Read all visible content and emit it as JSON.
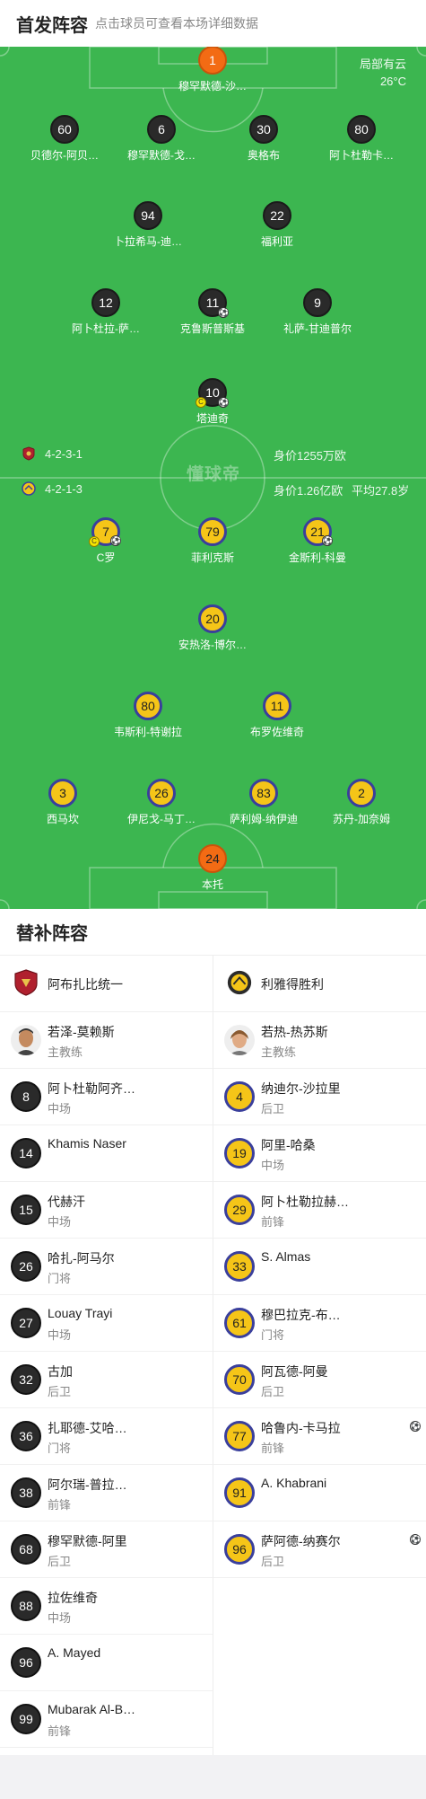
{
  "header": {
    "title": "首发阵容",
    "subtitle": "点击球员可查看本场详细数据"
  },
  "weather": {
    "condition": "局部有云",
    "temperature": "26°C"
  },
  "home_team": {
    "formation": "4-2-3-1",
    "value": "身价1255万欧",
    "colors": {
      "shirt": "#2a2a2a",
      "gk": "#f36b14",
      "logo": "#b0202e"
    },
    "players": [
      {
        "number": "1",
        "name": "穆罕默德-沙…",
        "gk": true
      },
      {
        "number": "60",
        "name": "贝德尔-阿贝…"
      },
      {
        "number": "6",
        "name": "穆罕默德-戈…"
      },
      {
        "number": "30",
        "name": "奥格布"
      },
      {
        "number": "80",
        "name": "阿卜杜勒卡…"
      },
      {
        "number": "94",
        "name": "卜拉希马-迪…"
      },
      {
        "number": "22",
        "name": "福利亚"
      },
      {
        "number": "12",
        "name": "阿卜杜拉-萨…"
      },
      {
        "number": "11",
        "name": "克鲁斯普斯基",
        "goal": true
      },
      {
        "number": "9",
        "name": "礼萨-甘迪普尔"
      },
      {
        "number": "10",
        "name": "塔迪奇",
        "captain": true,
        "goal": true
      }
    ]
  },
  "away_team": {
    "formation": "4-2-1-3",
    "value": "身价1.26亿欧",
    "avg_age": "平均27.8岁",
    "colors": {
      "shirt": "#f5c518",
      "trim": "#3a3f9c",
      "gk": "#f36b14"
    },
    "players": [
      {
        "number": "7",
        "name": "C罗",
        "captain": true,
        "goal": true
      },
      {
        "number": "79",
        "name": "菲利克斯"
      },
      {
        "number": "21",
        "name": "金斯利-科曼",
        "goal": true
      },
      {
        "number": "20",
        "name": "安热洛-博尔…"
      },
      {
        "number": "80",
        "name": "韦斯利-特谢拉"
      },
      {
        "number": "11",
        "name": "布罗佐维奇"
      },
      {
        "number": "3",
        "name": "西马坎"
      },
      {
        "number": "26",
        "name": "伊尼戈-马丁…"
      },
      {
        "number": "83",
        "name": "萨利姆-纳伊迪"
      },
      {
        "number": "2",
        "name": "苏丹-加奈姆"
      },
      {
        "number": "24",
        "name": "本托",
        "gk": true
      }
    ]
  },
  "watermark": "懂球帝",
  "subs": {
    "title": "替补阵容",
    "home": {
      "team_name": "阿布扎比统一",
      "coach": {
        "name": "若泽-莫赖斯",
        "role": "主教练"
      },
      "players": [
        {
          "number": "8",
          "name": "阿卜杜勒阿齐…",
          "pos": "中场"
        },
        {
          "number": "14",
          "name": "Khamis Naser",
          "pos": ""
        },
        {
          "number": "15",
          "name": "代赫汗",
          "pos": "中场"
        },
        {
          "number": "26",
          "name": "哈扎-阿马尔",
          "pos": "门将"
        },
        {
          "number": "27",
          "name": "Louay Trayi",
          "pos": "中场"
        },
        {
          "number": "32",
          "name": "古加",
          "pos": "后卫"
        },
        {
          "number": "36",
          "name": "扎耶德-艾哈…",
          "pos": "门将"
        },
        {
          "number": "38",
          "name": "阿尔瑞-普拉…",
          "pos": "前锋"
        },
        {
          "number": "68",
          "name": "穆罕默德-阿里",
          "pos": "后卫"
        },
        {
          "number": "88",
          "name": "拉佐维奇",
          "pos": "中场"
        },
        {
          "number": "96",
          "name": "A. Mayed",
          "pos": ""
        },
        {
          "number": "99",
          "name": "Mubarak Al-B…",
          "pos": "前锋"
        }
      ]
    },
    "away": {
      "team_name": "利雅得胜利",
      "coach": {
        "name": "若热-热苏斯",
        "role": "主教练"
      },
      "players": [
        {
          "number": "4",
          "name": "纳迪尔-沙拉里",
          "pos": "后卫"
        },
        {
          "number": "19",
          "name": "阿里-哈桑",
          "pos": "中场"
        },
        {
          "number": "29",
          "name": "阿卜杜勒拉赫…",
          "pos": "前锋"
        },
        {
          "number": "33",
          "name": "S. Almas",
          "pos": ""
        },
        {
          "number": "61",
          "name": "穆巴拉克-布…",
          "pos": "门将"
        },
        {
          "number": "70",
          "name": "阿瓦德-阿曼",
          "pos": "后卫"
        },
        {
          "number": "77",
          "name": "哈鲁内-卡马拉",
          "pos": "前锋",
          "goal": true
        },
        {
          "number": "91",
          "name": "A. Khabrani",
          "pos": ""
        },
        {
          "number": "96",
          "name": "萨阿德-纳赛尔",
          "pos": "后卫",
          "goal": true
        }
      ]
    }
  },
  "icons": {
    "goal": "⚽",
    "captain": "C"
  }
}
